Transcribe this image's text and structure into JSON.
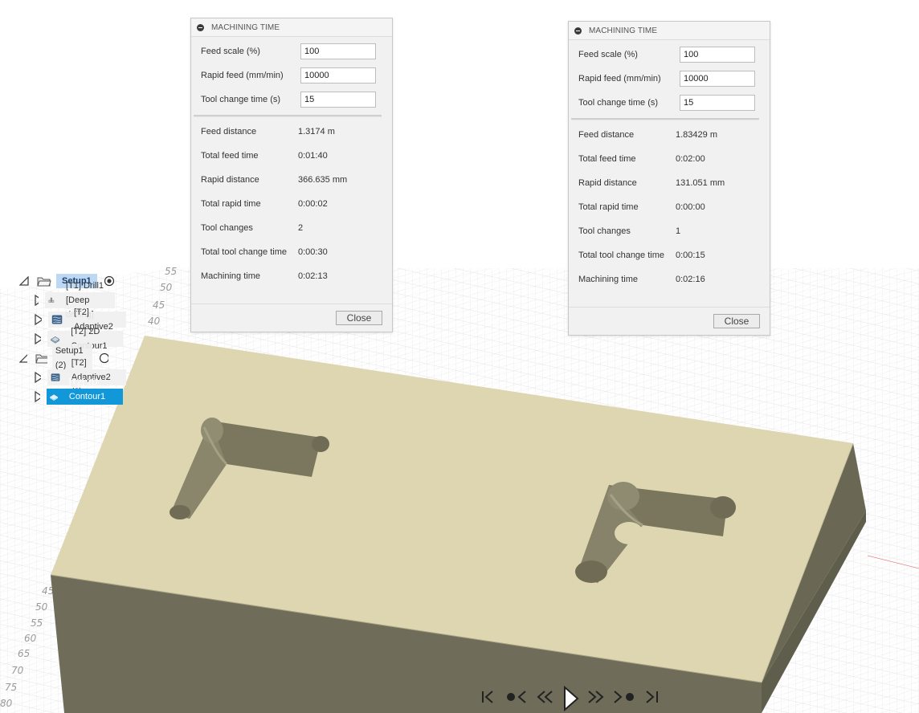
{
  "dialog_left": {
    "title": "MACHINING TIME",
    "inputs": [
      {
        "label": "Feed scale (%)",
        "value": "100"
      },
      {
        "label": "Rapid feed (mm/min)",
        "value": "10000"
      },
      {
        "label": "Tool change time (s)",
        "value": "15"
      }
    ],
    "stats": [
      {
        "label": "Feed distance",
        "value": "1.3174 m"
      },
      {
        "label": "Total feed time",
        "value": "0:01:40"
      },
      {
        "label": "Rapid distance",
        "value": "366.635 mm"
      },
      {
        "label": "Total rapid time",
        "value": "0:00:02"
      },
      {
        "label": "Tool changes",
        "value": "2"
      },
      {
        "label": "Total tool change time",
        "value": "0:00:30"
      },
      {
        "label": "Machining time",
        "value": "0:02:13"
      }
    ],
    "close_label": "Close"
  },
  "dialog_right": {
    "title": "MACHINING TIME",
    "inputs": [
      {
        "label": "Feed scale (%)",
        "value": "100"
      },
      {
        "label": "Rapid feed (mm/min)",
        "value": "10000"
      },
      {
        "label": "Tool change time (s)",
        "value": "15"
      }
    ],
    "stats": [
      {
        "label": "Feed distance",
        "value": "1.83429 m"
      },
      {
        "label": "Total feed time",
        "value": "0:02:00"
      },
      {
        "label": "Rapid distance",
        "value": "131.051 mm"
      },
      {
        "label": "Total rapid time",
        "value": "0:00:00"
      },
      {
        "label": "Tool changes",
        "value": "1"
      },
      {
        "label": "Total tool change time",
        "value": "0:00:15"
      },
      {
        "label": "Machining time",
        "value": "0:02:16"
      }
    ],
    "close_label": "Close"
  },
  "browser_tree": {
    "setup1": {
      "label": "Setup1",
      "active": true,
      "operations": [
        {
          "label": "[T1] Drill1 [Deep drilling]",
          "icon": "drill-icon"
        },
        {
          "label": "[T2] Adaptive2",
          "icon": "adaptive-icon"
        },
        {
          "label": "[T2] 2D Contour1",
          "icon": "contour-icon"
        }
      ]
    },
    "setup2": {
      "label": "Setup1 (2)",
      "active": false,
      "operations": [
        {
          "label": "[T2] Adaptive2 (2)",
          "icon": "adaptive-icon"
        },
        {
          "label": "[T2] 2D Contour1 (2)",
          "icon": "contour-icon",
          "selected": true
        }
      ]
    }
  },
  "viewport": {
    "tick_labels": [
      "55",
      "50",
      "45",
      "40",
      "45",
      "50",
      "55",
      "60",
      "65",
      "70",
      "75",
      "80"
    ],
    "colors": {
      "stock_top": "#ddd6b1",
      "stock_side": "#6e6c58",
      "pocket_wall": "#807c62",
      "grid": "#d4d4d4",
      "selection": "#1297d8"
    }
  },
  "playback": {
    "buttons": [
      "skip-to-start",
      "previous-operation",
      "step-back",
      "play",
      "step-forward",
      "next-operation",
      "skip-to-end"
    ]
  }
}
